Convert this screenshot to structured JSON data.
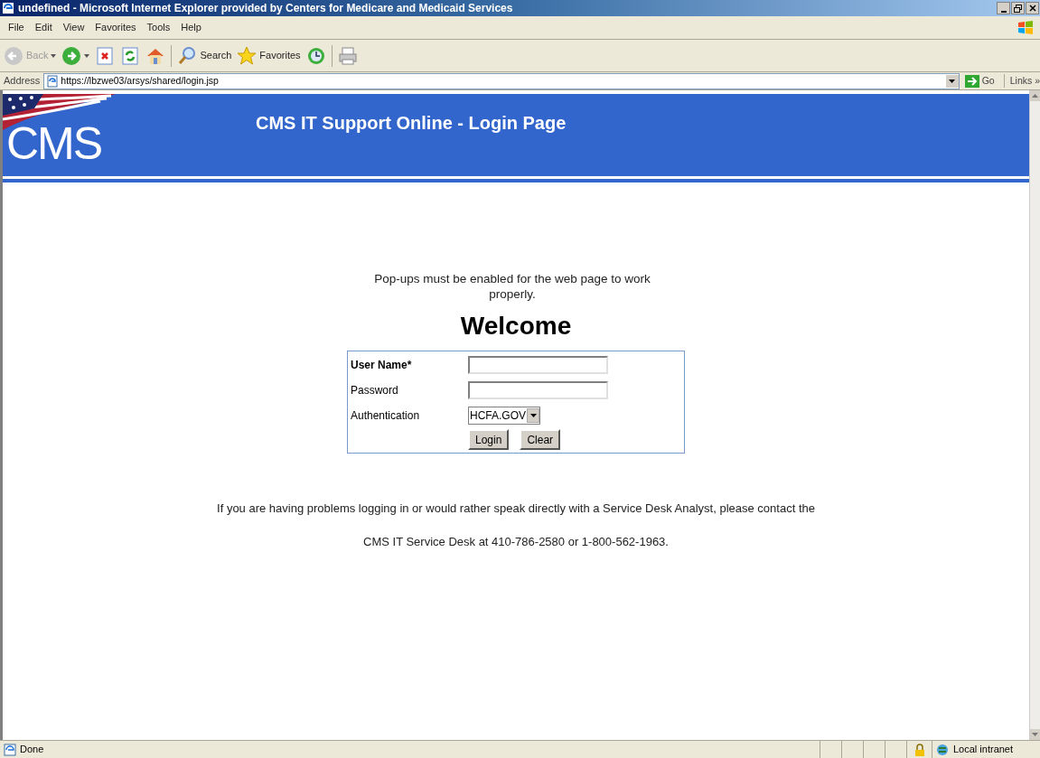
{
  "window": {
    "title": "undefined - Microsoft Internet Explorer provided by Centers for Medicare and Medicaid Services"
  },
  "menu": [
    "File",
    "Edit",
    "View",
    "Favorites",
    "Tools",
    "Help"
  ],
  "toolbar": [
    {
      "kind": "back",
      "label": "Back",
      "disabled": true
    },
    {
      "kind": "forward"
    },
    {
      "kind": "stop"
    },
    {
      "kind": "refresh"
    },
    {
      "kind": "home"
    },
    {
      "kind": "search",
      "label": "Search"
    },
    {
      "kind": "favorites",
      "label": "Favorites"
    },
    {
      "kind": "history"
    },
    {
      "kind": "print"
    }
  ],
  "address_bar": {
    "label": "Address",
    "value": "https://lbzwe03/arsys/shared/login.jsp",
    "go": "Go",
    "links": "Links",
    "more": "»"
  },
  "page": {
    "logo": "CMS",
    "heading": "CMS IT Support Online - Login Page",
    "notice": "Pop-ups must be enabled for the web page to work properly.",
    "welcome": "Welcome",
    "form": {
      "fields": [
        {
          "kind": "text",
          "label": "User Name*",
          "required": true
        },
        {
          "kind": "password",
          "label": "Password",
          "required": false
        },
        {
          "kind": "select",
          "label": "Authentication",
          "required": false,
          "value": "HCFA.GOV"
        }
      ],
      "buttons": [
        "Login",
        "Clear"
      ]
    },
    "help": [
      "If you are having problems logging in or would rather speak directly with a Service Desk Analyst, please contact the",
      "CMS IT Service Desk at 410-786-2580 or 1-800-562-1963."
    ]
  },
  "status_bar": {
    "text": "Done",
    "zone": "Local intranet"
  }
}
